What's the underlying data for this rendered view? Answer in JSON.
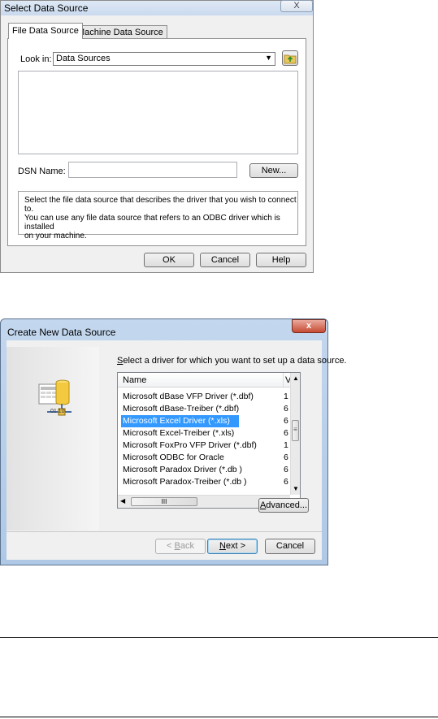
{
  "dialog1": {
    "title": "Select Data Source",
    "close_label": "X",
    "tabs": [
      {
        "label": "File Data Source"
      },
      {
        "label": "Machine Data Source"
      }
    ],
    "look_in_label": "Look in:",
    "look_in_value": "Data Sources",
    "dsn_label": "DSN Name:",
    "dsn_value": "",
    "new_button": "New...",
    "description_lines": [
      "Select the file data source that describes the driver that you wish to connect to.",
      "You can use any file data source that refers to an ODBC driver which is installed",
      "on your machine."
    ],
    "ok_button": "OK",
    "cancel_button": "Cancel",
    "help_button": "Help"
  },
  "dialog2": {
    "title": "Create New Data Source",
    "close_label": "x",
    "prompt_pre": "S",
    "prompt_rest": "elect a driver for which you want to set up a data source.",
    "columns": [
      "Name",
      "V"
    ],
    "drivers": [
      {
        "name": "Microsoft dBase VFP Driver (*.dbf)",
        "version": "1"
      },
      {
        "name": "Microsoft dBase-Treiber (*.dbf)",
        "version": "6"
      },
      {
        "name": "Microsoft Excel Driver (*.xls)",
        "version": "6",
        "selected": true
      },
      {
        "name": "Microsoft Excel-Treiber (*.xls)",
        "version": "6"
      },
      {
        "name": "Microsoft FoxPro VFP Driver (*.dbf)",
        "version": "1"
      },
      {
        "name": "Microsoft ODBC for Oracle",
        "version": "6"
      },
      {
        "name": "Microsoft Paradox Driver (*.db )",
        "version": "6"
      },
      {
        "name": "Microsoft Paradox-Treiber (*.db )",
        "version": "6"
      }
    ],
    "hscroll_thumb_label": "III",
    "advanced_button_pre": "A",
    "advanced_button_rest": "dvanced...",
    "back_button_pre": "< ",
    "back_button_u": "B",
    "back_button_rest": "ack",
    "next_button_pre": "",
    "next_button_u": "N",
    "next_button_rest": "ext >",
    "cancel_button": "Cancel",
    "icon_caption": "01 10"
  },
  "colors": {
    "selection": "#3399ff",
    "dialog_bg": "#f0f0f0",
    "aero_frame": "#b9cfea",
    "close_red": "#c74b34"
  }
}
